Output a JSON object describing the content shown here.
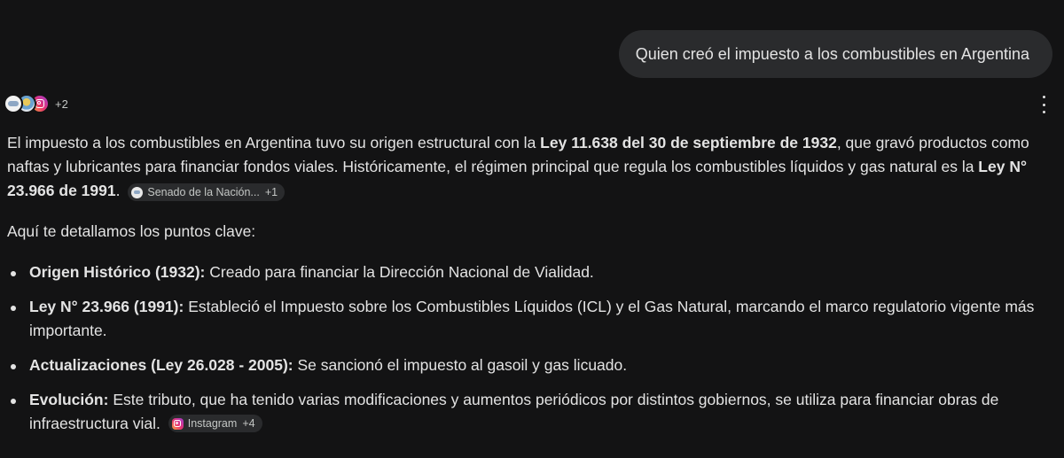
{
  "user_message": "Quien creó el impuesto a los combustibles en Argentina",
  "sources": {
    "favicons": [
      "senado-icon",
      "argentina-gov-icon",
      "instagram-icon"
    ],
    "extra_count": "+2"
  },
  "menu": {
    "icon": "more-vert-icon"
  },
  "answer": {
    "intro": {
      "t1": "El impuesto a los combustibles en Argentina tuvo su origen estructural con la ",
      "b1": "Ley 11.638 del 30 de septiembre de 1932",
      "t2": ", que gravó productos como naftas y lubricantes para financiar fondos viales. Históricamente, el régimen principal que regula los combustibles líquidos y gas natural es la ",
      "b2": "Ley N° 23.966 de 1991",
      "t3": ".",
      "chip": {
        "icon": "senado-icon",
        "label": "Senado de la Nación...",
        "count": "+1"
      }
    },
    "lead": "Aquí te detallamos los puntos clave:",
    "points": [
      {
        "title": "Origen Histórico (1932):",
        "text": " Creado para financiar la Dirección Nacional de Vialidad."
      },
      {
        "title": "Ley N° 23.966 (1991):",
        "text": " Estableció el Impuesto sobre los Combustibles Líquidos (ICL) y el Gas Natural, marcando el marco regulatorio vigente más importante."
      },
      {
        "title": "Actualizaciones (Ley 26.028 - 2005):",
        "text": " Se sancionó el impuesto al gasoil y gas licuado."
      },
      {
        "title": "Evolución:",
        "text": " Este tributo, que ha tenido varias modificaciones y aumentos periódicos por distintos gobiernos, se utiliza para financiar obras de infraestructura vial.",
        "chip": {
          "icon": "instagram-icon",
          "label": "Instagram",
          "count": "+4"
        }
      }
    ]
  },
  "colors": {
    "background": "#131314",
    "bubble": "#2a2b2d",
    "text": "#e3e3e3",
    "muted": "#c4c7c5"
  }
}
